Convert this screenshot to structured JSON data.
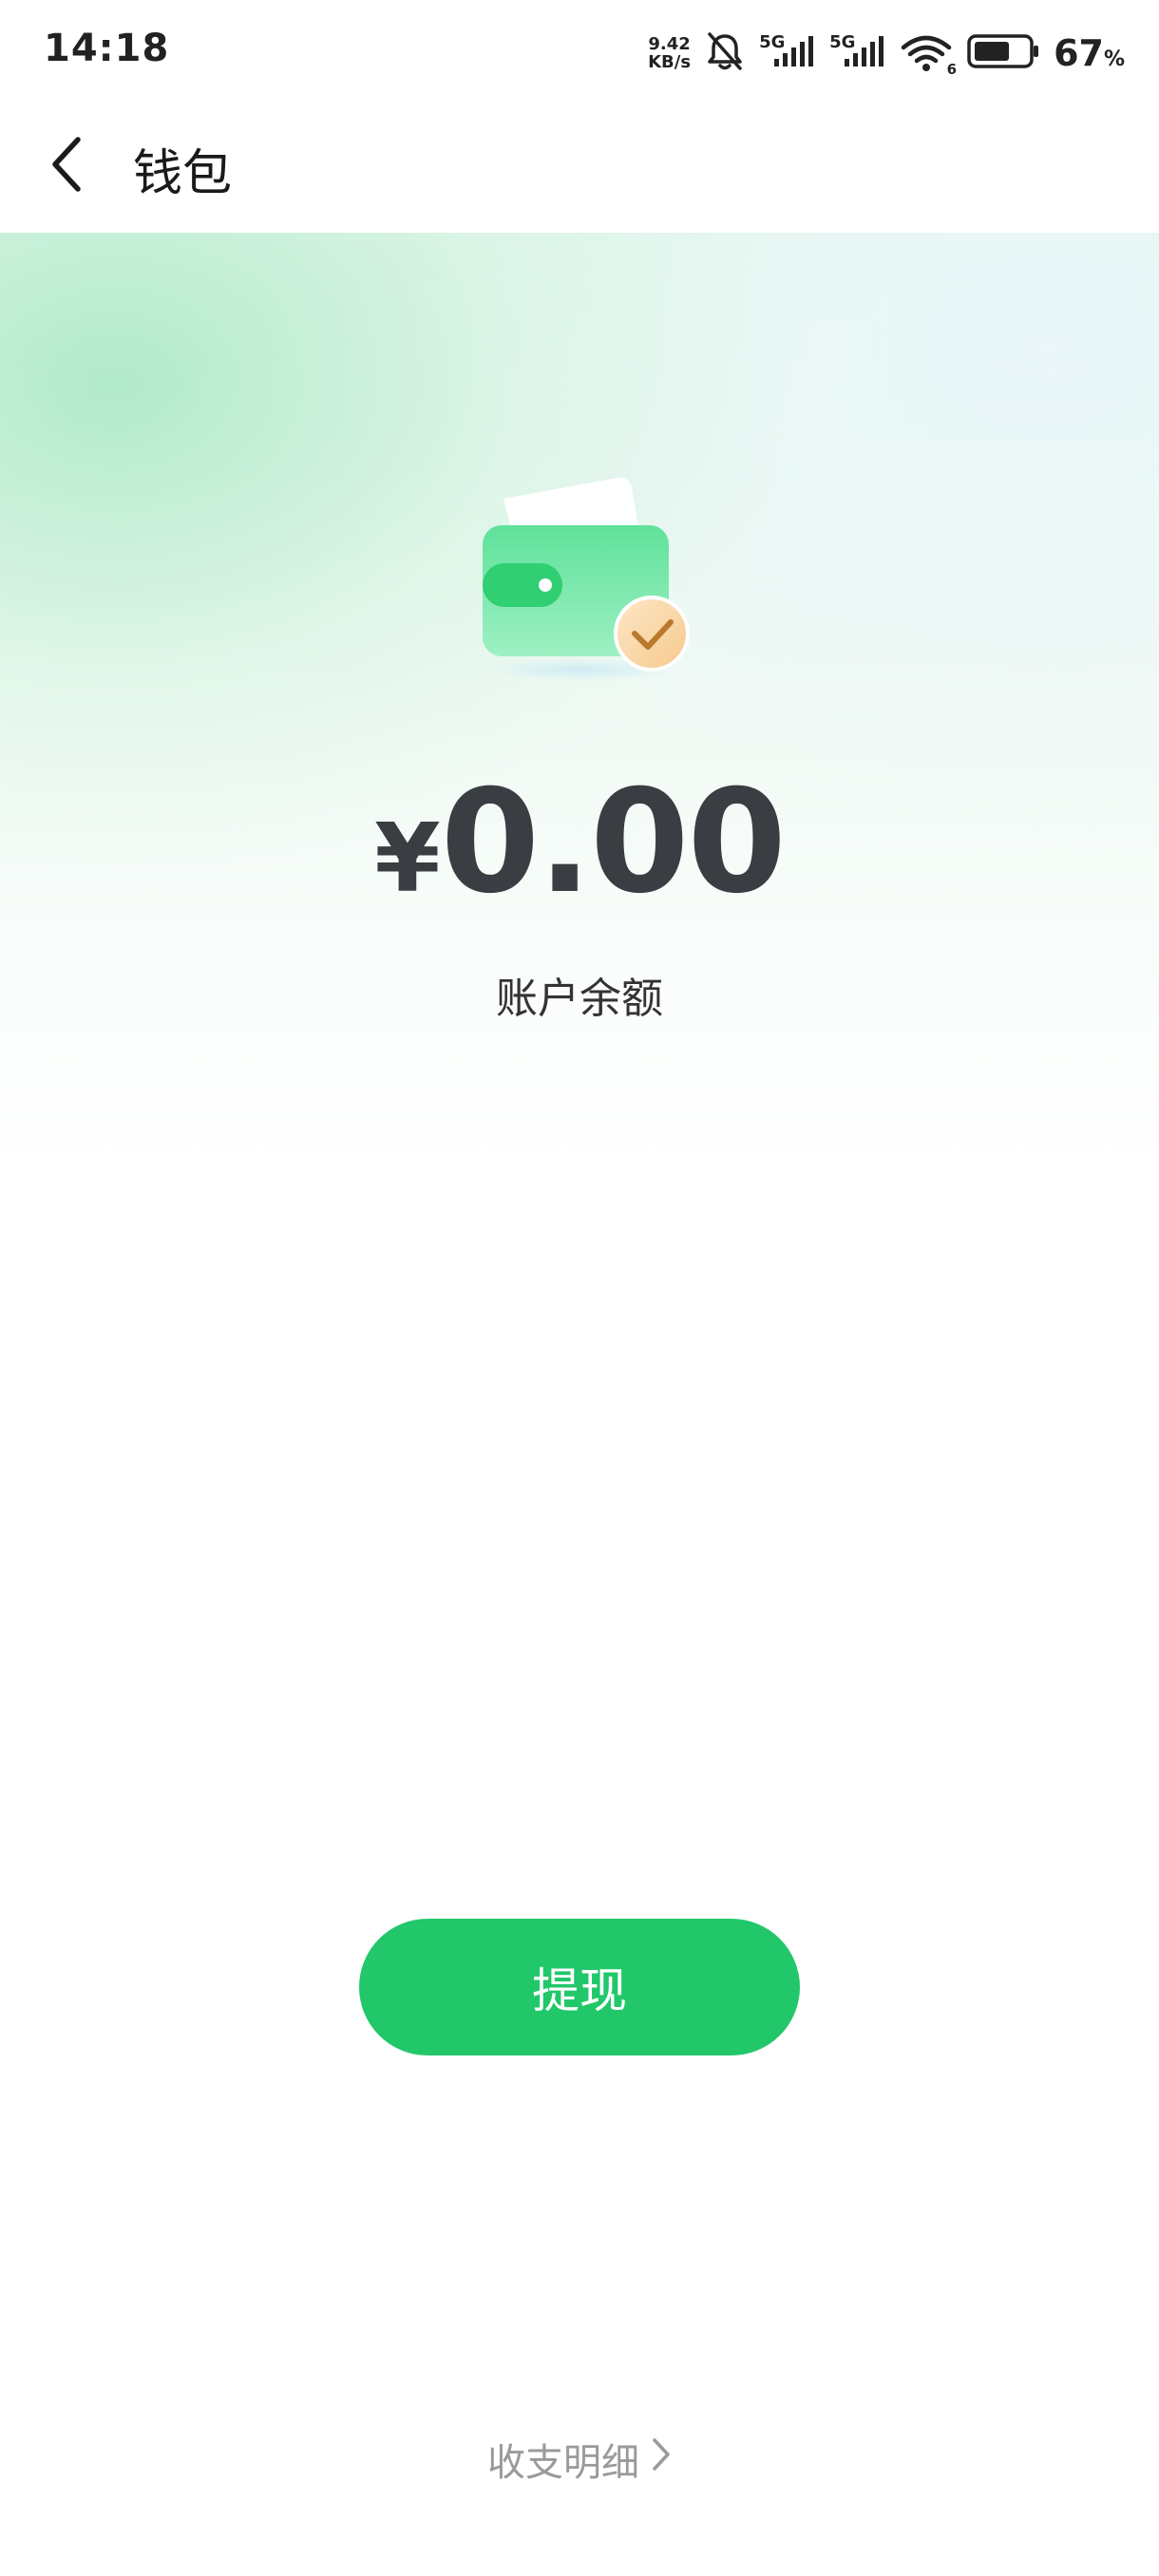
{
  "status_bar": {
    "time": "14:18",
    "net_speed_value": "9.42",
    "net_speed_unit": "KB/s",
    "sim1_label": "5G",
    "sim2_label": "5G",
    "wifi_sub": "6",
    "battery_value": "67",
    "battery_unit": "%",
    "battery_level": 0.67
  },
  "header": {
    "title": "钱包"
  },
  "balance": {
    "currency": "¥",
    "amount": "0.00",
    "label": "账户余额"
  },
  "actions": {
    "withdraw_label": "提现",
    "details_label": "收支明细"
  },
  "colors": {
    "accent": "#22c76a",
    "balance_text": "#3a3d42",
    "muted_text": "#9a9a9a"
  }
}
